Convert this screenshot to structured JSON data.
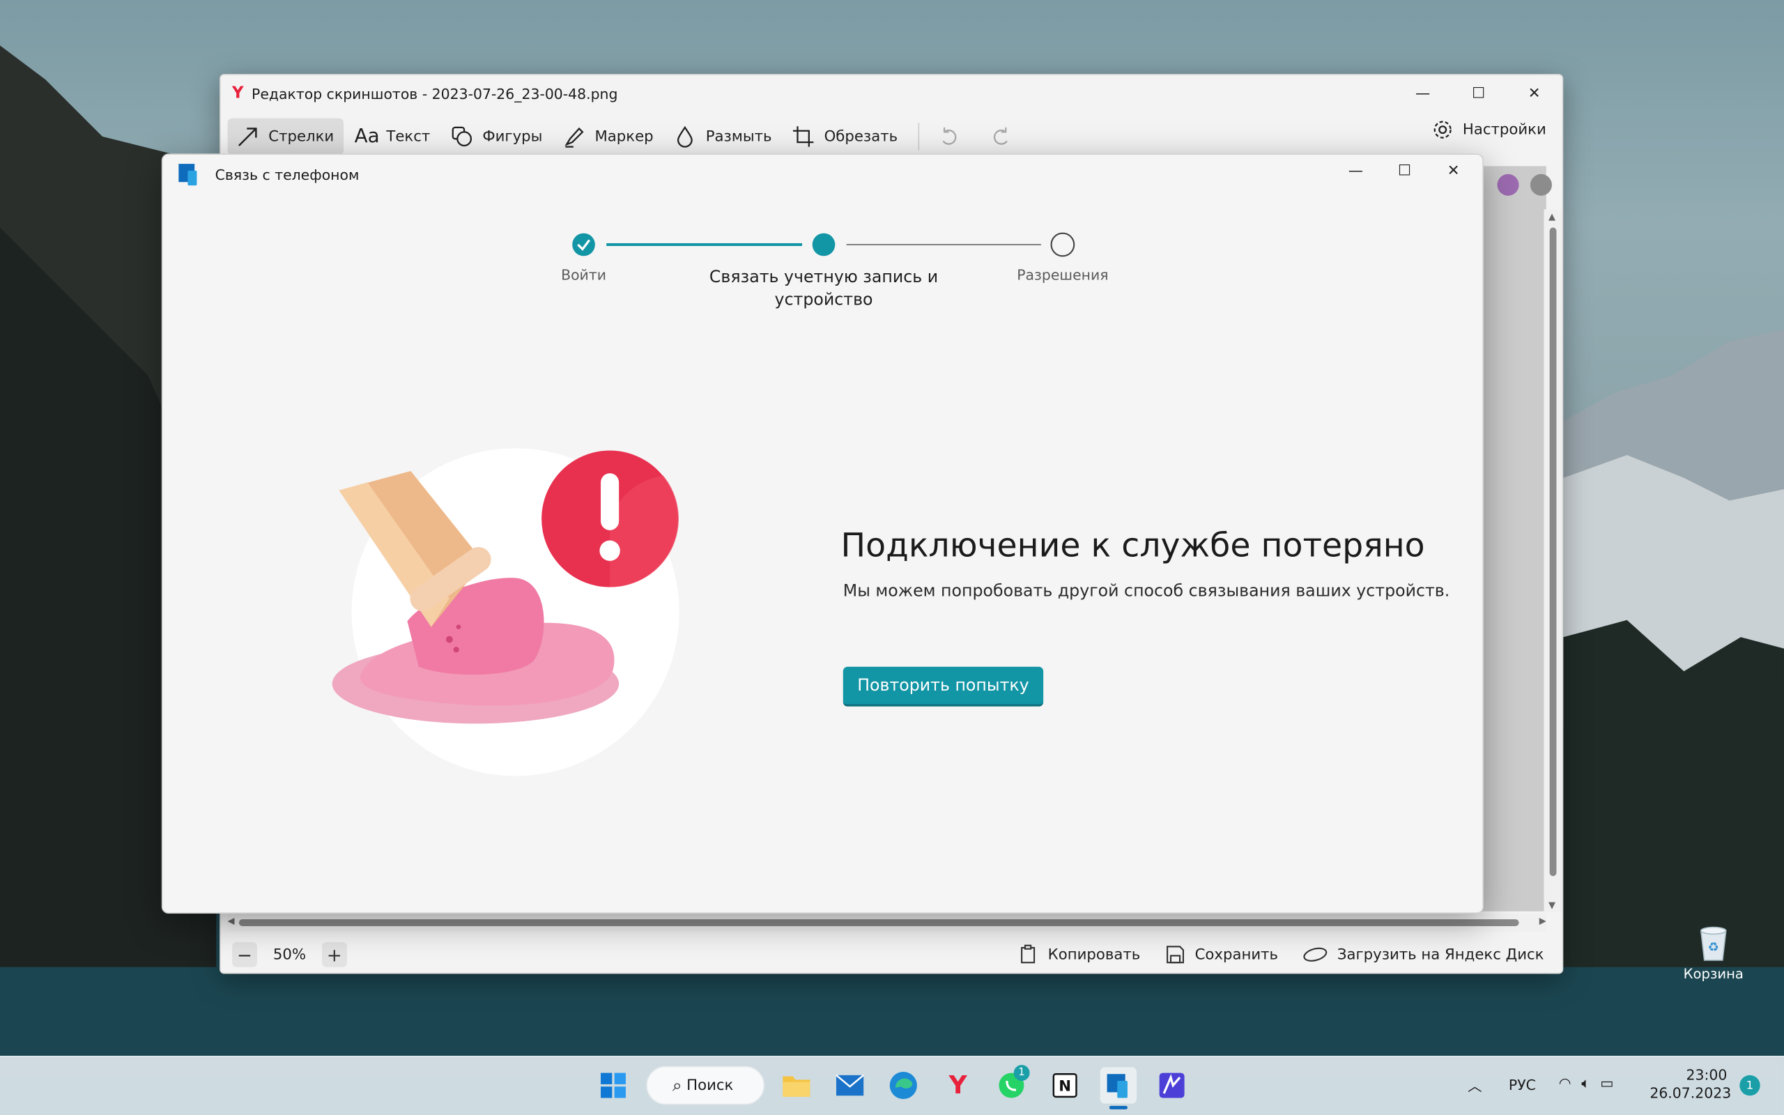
{
  "editor": {
    "title": "Редактор скриншотов - 2023-07-26_23-00-48.png",
    "window_controls": [
      "—",
      "☐",
      "✕"
    ],
    "tools": [
      {
        "label": "Стрелки",
        "icon": "arrow-icon",
        "active": true
      },
      {
        "label": "Текст",
        "icon": "text-icon",
        "prefix": "Aa"
      },
      {
        "label": "Фигуры",
        "icon": "shapes-icon"
      },
      {
        "label": "Маркер",
        "icon": "marker-icon"
      },
      {
        "label": "Размыть",
        "icon": "blur-icon"
      },
      {
        "label": "Обрезать",
        "icon": "crop-icon"
      }
    ],
    "settings_label": "Настройки",
    "zoom": "50%",
    "zoom_out": "−",
    "zoom_in": "+",
    "bottom_actions": [
      {
        "label": "Копировать",
        "icon": "copy-icon"
      },
      {
        "label": "Сохранить",
        "icon": "save-icon"
      },
      {
        "label": "Загрузить на Яндекс Диск",
        "icon": "yandex-disk-icon"
      }
    ],
    "color_swatches": [
      "#9c6bb0",
      "#8c8c8c"
    ]
  },
  "phone_link": {
    "title": "Связь с телефоном",
    "steps": [
      {
        "label": "Войти",
        "state": "done"
      },
      {
        "label": "Связать учетную запись и устройство",
        "state": "current"
      },
      {
        "label": "Разрешения",
        "state": "pending"
      }
    ],
    "headline": "Подключение к службе потеряно",
    "subtitle": "Мы можем попробовать другой способ связывания ваших устройств.",
    "retry_button": "Повторить попытку",
    "accent_color": "#1295a5"
  },
  "desktop": {
    "recycle_bin_label": "Корзина"
  },
  "taskbar": {
    "search_label": "Поиск",
    "whatsapp_badge": "1",
    "language": "РУС",
    "time": "23:00",
    "date": "26.07.2023",
    "notification_count": "1"
  }
}
